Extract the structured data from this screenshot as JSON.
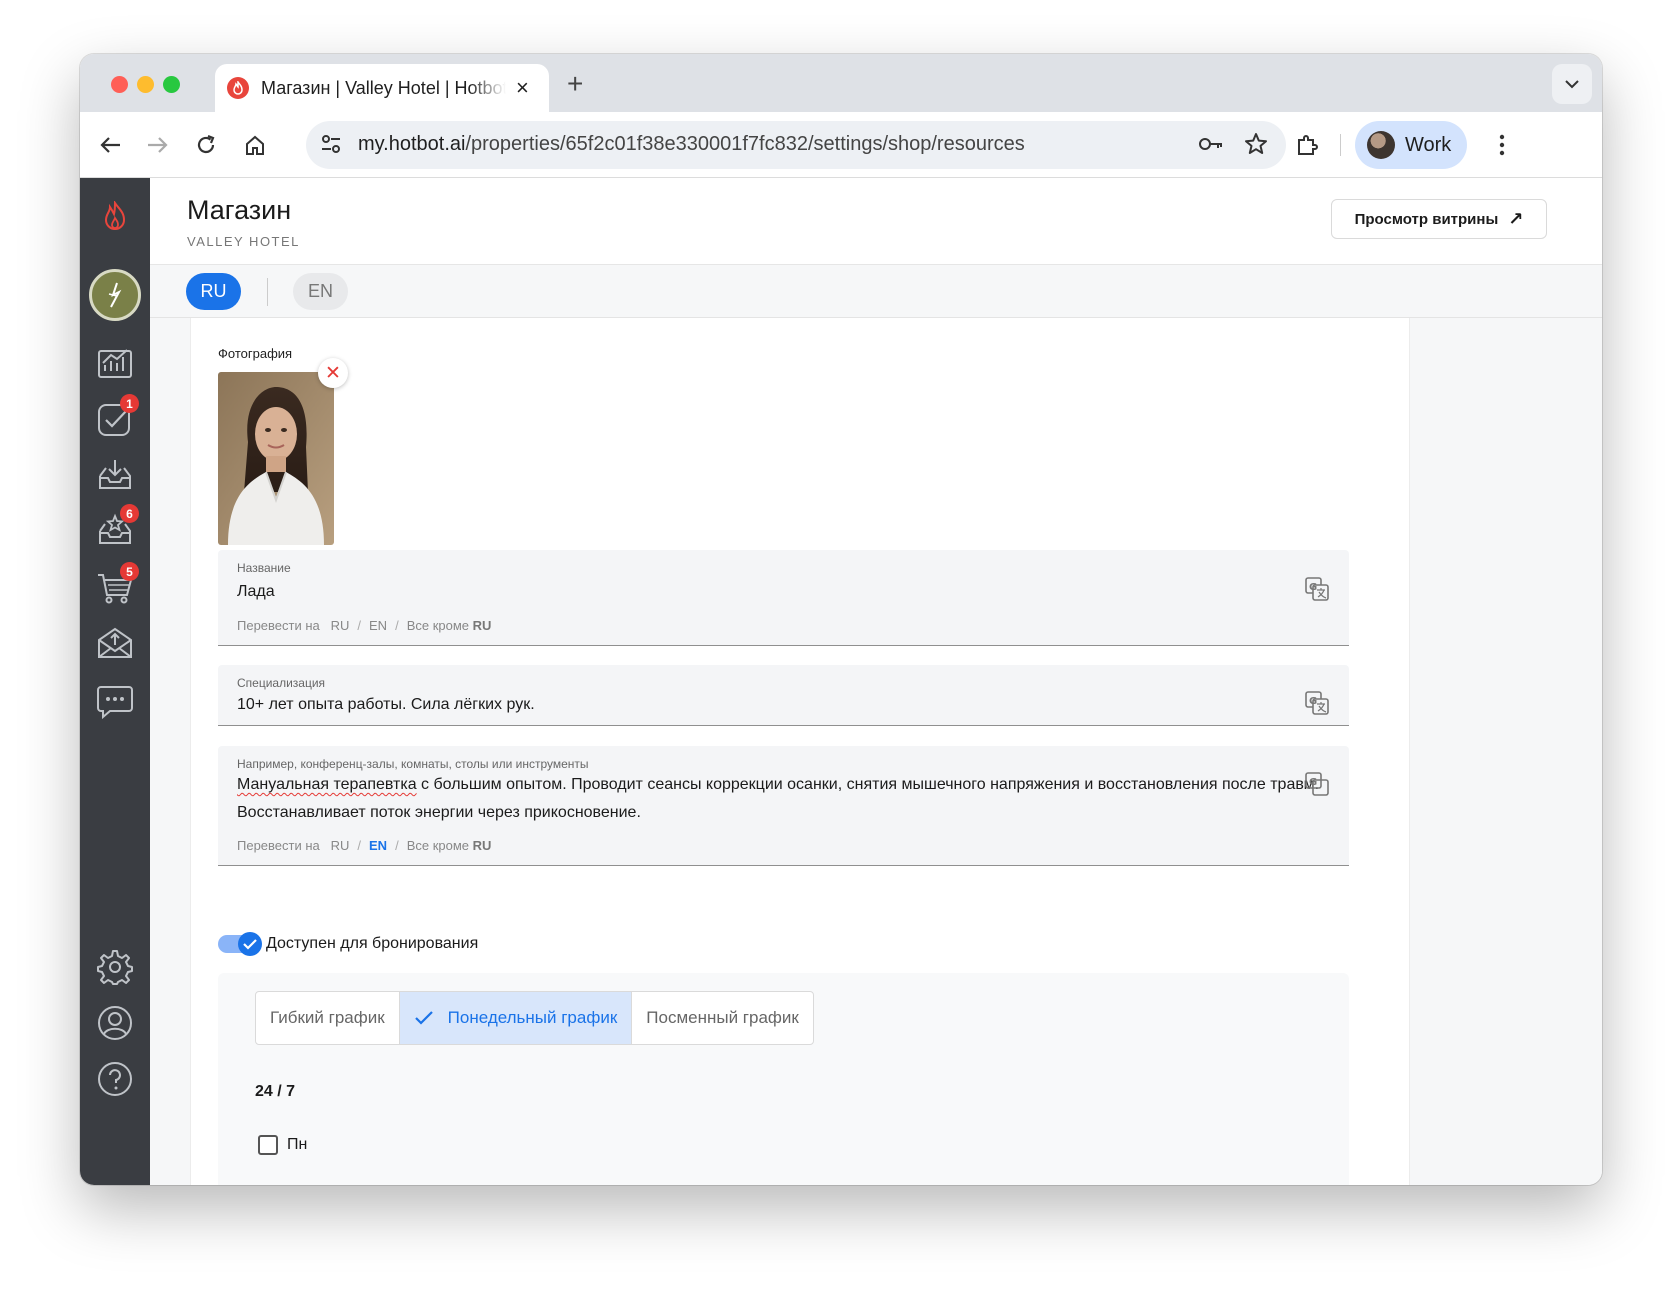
{
  "browser": {
    "tab_title": "Магазин | Valley Hotel | Hotbot",
    "tab_close": "×",
    "new_tab": "+",
    "url_host": "my.hotbot.ai",
    "url_path": "/properties/65f2c01f38e330001f7fc832/settings/shop/resources",
    "profile_label": "Work"
  },
  "sidebar": {
    "badges": {
      "tasks": "1",
      "reviews": "6",
      "shop": "5"
    }
  },
  "header": {
    "title": "Магазин",
    "subtitle": "VALLEY HOTEL",
    "preview_button": "Просмотр витрины",
    "preview_arrow": "↗"
  },
  "languages": {
    "ru": "RU",
    "en": "EN"
  },
  "form": {
    "photo_label": "Фотография",
    "photo_remove": "✕",
    "name": {
      "label": "Название",
      "value": "Лада",
      "translate": {
        "prefix": "Перевести на",
        "ru": "RU",
        "en": "EN",
        "except_prefix": "Все кроме",
        "except_lang": "RU"
      }
    },
    "specialization": {
      "label": "Специализация",
      "value": "10+ лет опыта работы. Сила лёгких рук."
    },
    "description": {
      "label": "Например, конференц-залы, комнаты, столы или инструменты",
      "value_misspelled": "Мануальная терапевтка",
      "value_rest": " с большим опытом. Проводит сеансы коррекции осанки, снятия мышечного напряжения и восстановления после травм. Восстанавливает поток энергии через прикосновение.",
      "translate": {
        "prefix": "Перевести на",
        "ru": "RU",
        "en": "EN",
        "except_prefix": "Все кроме",
        "except_lang": "RU"
      }
    },
    "bookable_label": "Доступен для бронирования",
    "schedule": {
      "options": [
        "Гибкий график",
        "Понедельный график",
        "Посменный график"
      ],
      "selected": "Понедельный график",
      "mode": "24 / 7",
      "days": [
        "Пн"
      ]
    }
  },
  "colors": {
    "accent": "#1a73e8",
    "sidebar": "#3a3d42",
    "badge": "#e53935"
  }
}
